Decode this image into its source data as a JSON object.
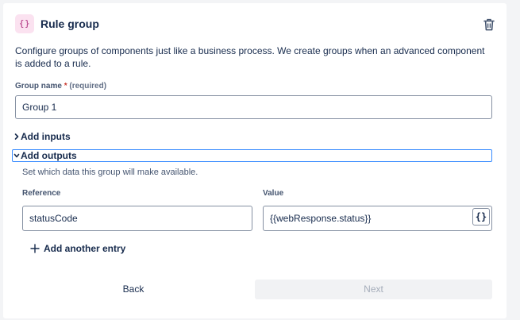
{
  "header": {
    "icon": "curly-braces-icon",
    "icon_glyph": "{}",
    "title": "Rule group",
    "delete_icon": "trash-icon"
  },
  "description": "Configure groups of components just like a business process. We create groups when an advanced component is added to a rule.",
  "group_name": {
    "label": "Group name",
    "required_marker": "*",
    "required_text": "(required)",
    "value": "Group 1"
  },
  "add_inputs": {
    "label": "Add inputs",
    "expanded": false
  },
  "add_outputs": {
    "label": "Add outputs",
    "expanded": true,
    "description": "Set which data this group will make available.",
    "columns": {
      "reference": "Reference",
      "value": "Value"
    },
    "entries": [
      {
        "reference": "statusCode",
        "value": "{{webResponse.status}}"
      }
    ],
    "variable_button_glyph": "{}",
    "add_entry_label": "Add another entry"
  },
  "footer": {
    "back_label": "Back",
    "next_label": "Next"
  },
  "colors": {
    "accent_focus": "#388bff",
    "icon_bg": "#fbe2f0",
    "icon_fg": "#ae2e7d",
    "required": "#c9372c",
    "disabled_bg": "#f1f2f4",
    "disabled_text": "#a5adba"
  }
}
